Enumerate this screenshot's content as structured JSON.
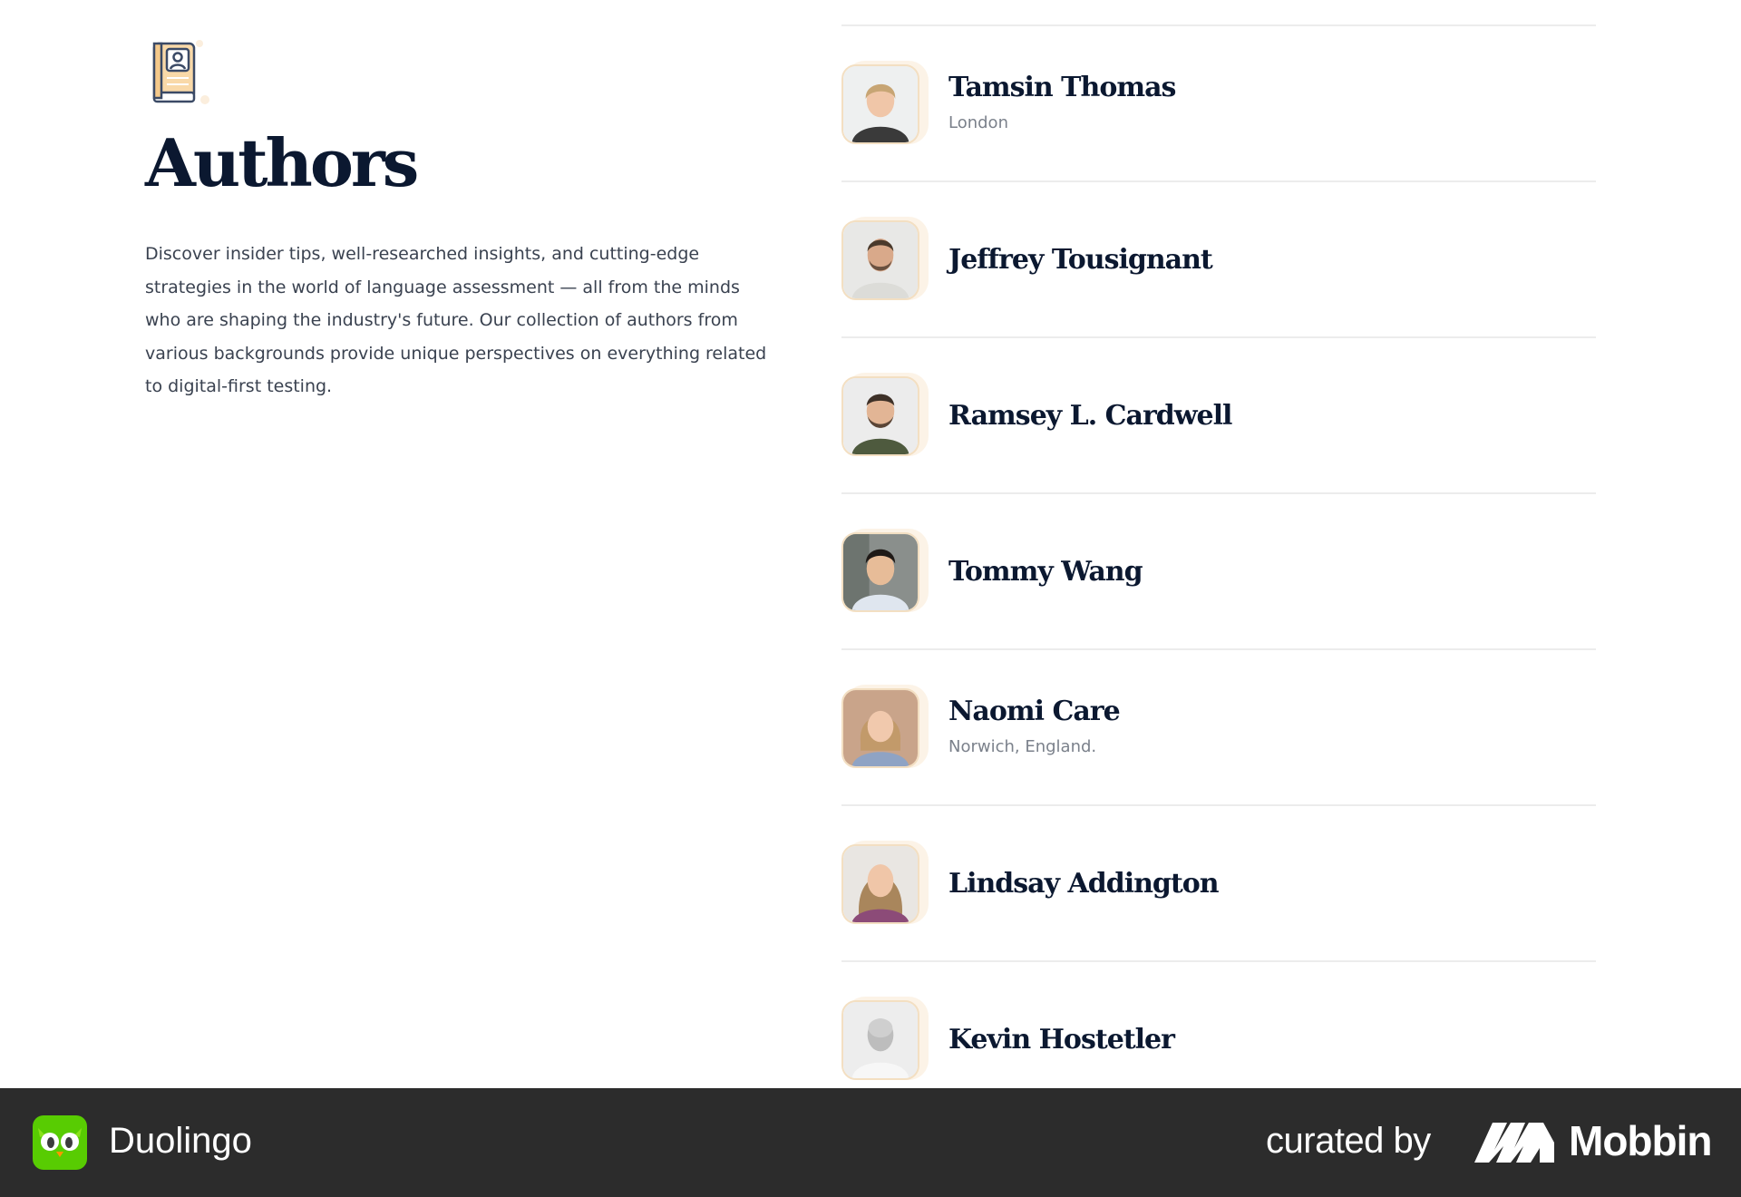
{
  "page": {
    "title": "Authors",
    "intro": "Discover insider tips, well-researched insights, and cutting-edge strategies in the world of language assessment — all from the minds who are shaping the industry's future. Our collection of authors from various backgrounds provide unique perspectives on everything related to digital-first testing."
  },
  "authors": [
    {
      "name": "Tamsin Thomas",
      "location": "London"
    },
    {
      "name": "Jeffrey Tousignant",
      "location": ""
    },
    {
      "name": "Ramsey L. Cardwell",
      "location": ""
    },
    {
      "name": "Tommy Wang",
      "location": ""
    },
    {
      "name": "Naomi Care",
      "location": "Norwich, England."
    },
    {
      "name": "Lindsay Addington",
      "location": ""
    },
    {
      "name": "Kevin Hostetler",
      "location": ""
    }
  ],
  "footer": {
    "app_name": "Duolingo",
    "curated_label": "curated by",
    "curator_name": "Mobbin"
  },
  "colors": {
    "heading": "#0b1830",
    "body_text": "#3a4250",
    "muted_text": "#7b818b",
    "divider": "#ececec",
    "footer_bg": "#2c2c2c",
    "duolingo_green": "#58cc02",
    "avatar_halo": "#fbeedd"
  }
}
